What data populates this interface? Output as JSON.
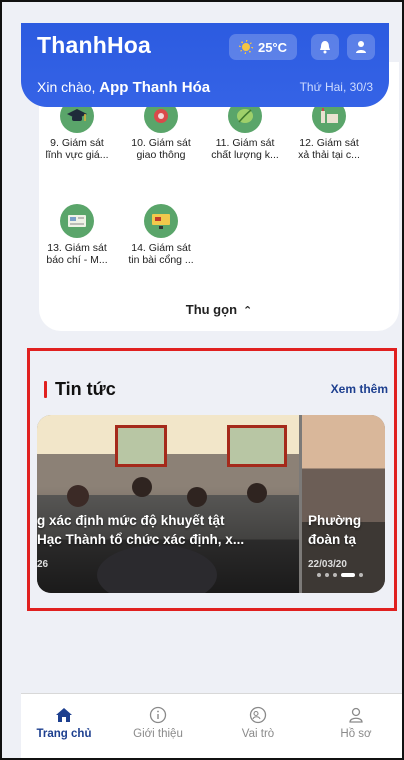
{
  "header": {
    "brand": "ThanhHoa",
    "temperature": "25°C",
    "greeting_prefix": "Xin chào,",
    "greeting_name": "App Thanh Hóa",
    "date": "Thứ Hai, 30/3"
  },
  "services": [
    {
      "line1": "9. Giám sát",
      "line2": "lĩnh vực giá...",
      "icon": "graduation-cap-icon"
    },
    {
      "line1": "10. Giám sát",
      "line2": "giao thông",
      "icon": "traffic-camera-icon"
    },
    {
      "line1": "11. Giám sát",
      "line2": "chất lượng k...",
      "icon": "leaf-icon"
    },
    {
      "line1": "12. Giám sát",
      "line2": "xả thải tại c...",
      "icon": "factory-icon"
    },
    {
      "line1": "13. Giám sát",
      "line2": "báo chí - M...",
      "icon": "newspaper-icon"
    },
    {
      "line1": "14. Giám sát",
      "line2": "tin bài cổng ...",
      "icon": "monitor-icon"
    }
  ],
  "collapse_label": "Thu gọn",
  "news": {
    "title": "Tin tức",
    "see_more": "Xem thêm",
    "slides": [
      {
        "line1": "g xác định mức độ khuyết tật",
        "line2": "Hạc Thành tổ chức xác định, x...",
        "date": "26"
      },
      {
        "line1": "Phường",
        "line2": "đoàn tạ",
        "date": "22/03/20"
      }
    ]
  },
  "nav": [
    {
      "label": "Trang chủ",
      "icon": "home-icon",
      "active": true
    },
    {
      "label": "Giới thiệu",
      "icon": "info-icon",
      "active": false
    },
    {
      "label": "Vai trò",
      "icon": "role-icon",
      "active": false
    },
    {
      "label": "Hồ sơ",
      "icon": "profile-icon",
      "active": false
    }
  ],
  "colors": {
    "header_blue": "#2f5fe0",
    "accent_navy": "#1d3f8f",
    "highlight_red": "#e0201f",
    "icon_green": "#5aa56a"
  }
}
